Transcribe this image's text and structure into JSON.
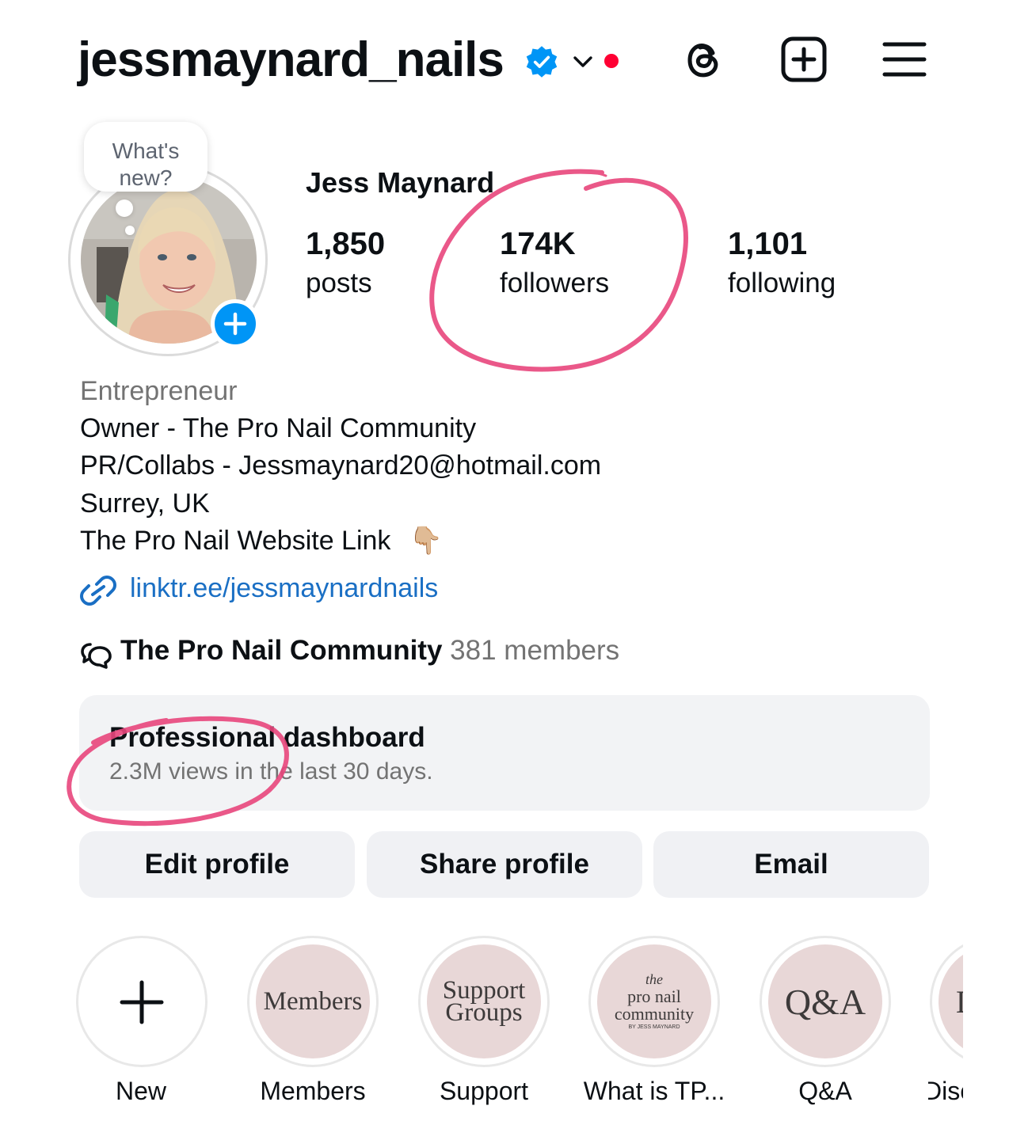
{
  "header": {
    "username": "jessmaynard_nails",
    "icons": [
      "verified-badge-icon",
      "chevron-down-icon",
      "notification-dot",
      "threads-icon",
      "create-post-icon",
      "menu-icon"
    ],
    "accent_color": "#0095f6",
    "dot_color": "#ff0033"
  },
  "profile": {
    "note_bubble": "What's new?",
    "display_name": "Jess Maynard",
    "stats": {
      "posts": {
        "value": "1,850",
        "label": "posts"
      },
      "followers": {
        "value": "174K",
        "label": "followers"
      },
      "following": {
        "value": "1,101",
        "label": "following"
      }
    }
  },
  "bio": {
    "category": "Entrepreneur",
    "line1": "Owner - The Pro Nail Community",
    "line2": "PR/Collabs - Jessmaynard20@hotmail.com",
    "line3": "Surrey, UK",
    "line4": "The Pro Nail Website Link",
    "line4_emoji": "👇🏼",
    "link": "linktr.ee/jessmaynardnails",
    "link_color": "#1a6fc4"
  },
  "community": {
    "name": "The Pro Nail Community",
    "members": "381 members"
  },
  "dashboard": {
    "title": "Professional dashboard",
    "subtitle": "2.3M views in the last 30 days."
  },
  "buttons": {
    "edit": "Edit profile",
    "share": "Share profile",
    "email": "Email"
  },
  "highlights": [
    {
      "label": "New",
      "cover": "+"
    },
    {
      "label": "Members",
      "cover": "Members"
    },
    {
      "label": "Support",
      "cover_line1": "Support",
      "cover_line2": "Groups"
    },
    {
      "label": "What is TP...",
      "cover_line1": "the",
      "cover_line2": "pro nail",
      "cover_line3": "community",
      "cover_line4": "BY JESS MAYNARD"
    },
    {
      "label": "Q&A",
      "cover": "Q&A"
    },
    {
      "label": "Disc",
      "cover": "D"
    }
  ],
  "annotation_color": "#e8467c"
}
